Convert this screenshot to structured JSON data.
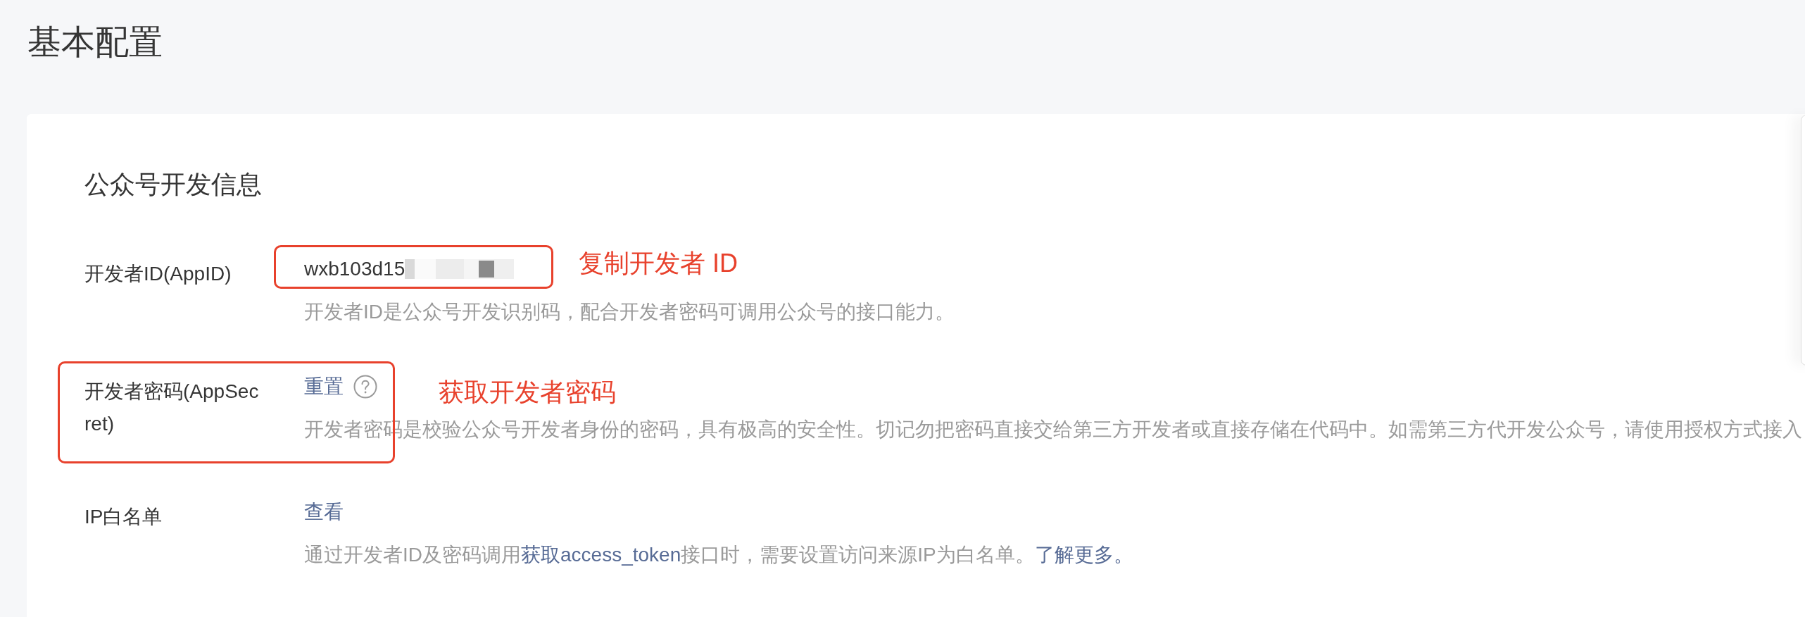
{
  "page": {
    "title": "基本配置"
  },
  "section": {
    "title": "公众号开发信息",
    "rows": [
      {
        "kind": "value",
        "label": "开发者ID(AppID)",
        "value": "wxb103d15",
        "redacted": true,
        "description": [
          {
            "kind": "text",
            "text": "开发者ID是公众号开发识别码，配合开发者密码可调用公众号的接口能力。"
          }
        ],
        "annotation": {
          "kind": "value",
          "text": "复制开发者 ID"
        }
      },
      {
        "kind": "action",
        "label": "开发者密码(AppSecret)",
        "action": "重置",
        "help": true,
        "description": [
          {
            "kind": "text",
            "text": "开发者密码是校验公众号开发者身份的密码，具有极高的安全性。切记勿把密码直接交给第三方开发者或直接存储在代码中。如需第三方代开发公众号，请使用授权方式接入"
          }
        ],
        "annotation": {
          "kind": "row",
          "text": "获取开发者密码"
        }
      },
      {
        "kind": "action",
        "label": "IP白名单",
        "action": "查看",
        "description": [
          {
            "kind": "text",
            "text": "通过开发者ID及密码调用"
          },
          {
            "kind": "link",
            "text": "获取access_token"
          },
          {
            "kind": "text",
            "text": "接口时，需要设置访问来源IP为白名单。"
          },
          {
            "kind": "link",
            "text": "了解更多。"
          }
        ]
      }
    ]
  }
}
